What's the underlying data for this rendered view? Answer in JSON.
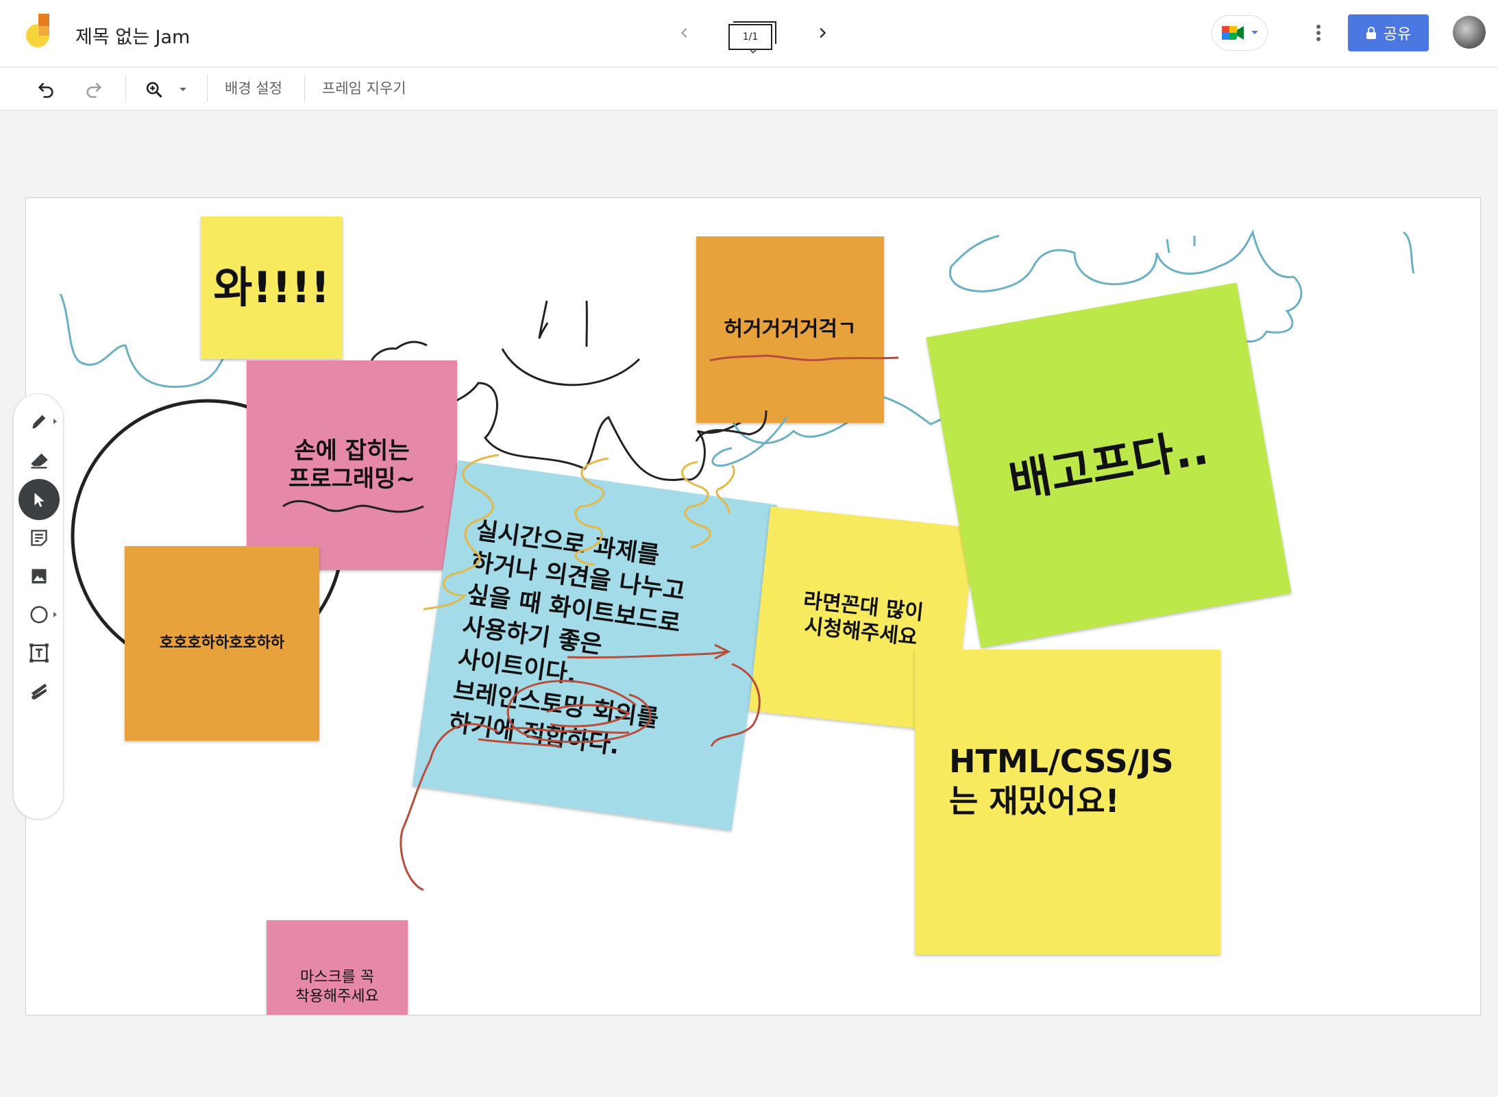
{
  "app": {
    "title": "제목 없는 Jam",
    "logo_icon": "jamboard-logo"
  },
  "header": {
    "frame_counter": "1/1",
    "share_label": "공유",
    "icons": [
      "chevron-left-icon",
      "chevron-right-icon",
      "google-meet-icon",
      "more-vert-icon",
      "lock-icon"
    ]
  },
  "toolbar": {
    "background_label": "배경 설정",
    "clear_frame_label": "프레임 지우기",
    "icons": [
      "undo-icon",
      "redo-icon",
      "zoom-in-icon",
      "dropdown-icon"
    ]
  },
  "palette": {
    "tools": [
      "pen-icon",
      "eraser-icon",
      "select-icon",
      "sticky-note-icon",
      "image-icon",
      "shape-icon",
      "text-box-icon",
      "laser-icon"
    ],
    "active_tool": "select-icon"
  },
  "notes": {
    "wow": "와!!!!",
    "hands1": "손에 잡히는",
    "hands2": "프로그래밍~",
    "hoho": "호호호하하호호하하",
    "heo": "허거거거거걱ㄱ",
    "main1": "실시간으로 과제를",
    "main2": "하거나 의견을 나누고",
    "main3": "싶을 때 화이트보드로",
    "main4": "사용하기 좋은",
    "main5": "사이트이다.",
    "main6": "브레인스토밍 회의를",
    "main7": "하기에 적합하다.",
    "ramen1": "라면꼰대 많이",
    "ramen2": "시청해주세요",
    "hungry": "배고프다..",
    "html1": "HTML/CSS/JS",
    "html2": "는 재밌어요!",
    "mask1": "마스크를 꼭",
    "mask2": "착용해주세요"
  },
  "colors": {
    "yellow": "#f7ea5e",
    "pink": "#e688a8",
    "orange": "#e8a23b",
    "blue": "#a4dbe8",
    "green": "#bde84a",
    "share_blue": "#4a78e0",
    "ink_teal": "#6ab0c4",
    "ink_black": "#222222",
    "ink_gold": "#e4b846",
    "ink_red": "#b84c3a"
  }
}
